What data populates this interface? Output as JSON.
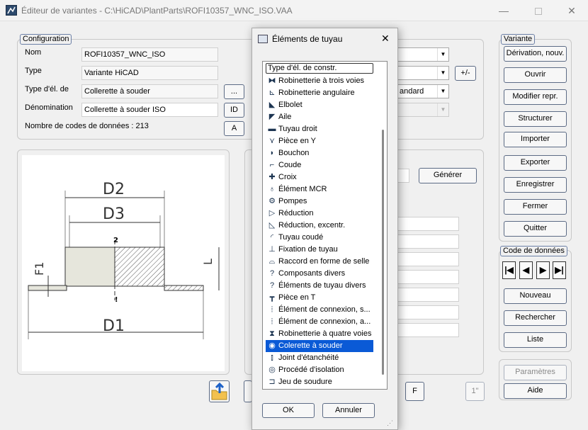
{
  "window": {
    "title": "Éditeur de variantes - C:\\HiCAD\\PlantParts\\ROFI10357_WNC_ISO.VAA",
    "minimize_icon": "minimize-icon",
    "maximize_icon": "maximize-icon",
    "close_label": "✕"
  },
  "configuration": {
    "legend": "Configuration",
    "nom_label": "Nom",
    "nom_value": "ROFI10357_WNC_ISO",
    "type_label": "Type",
    "type_value": "Variante HiCAD",
    "type_el_label": "Type d'él. de",
    "type_el_value": "Collerette à souder",
    "dots_button": "...",
    "denom_label": "Dénomination",
    "denom_value": "Collerette à souder ISO",
    "id_button": "ID",
    "nb_codes_label": "Nombre de codes de données : 213",
    "a_button": "A",
    "plus_minus_button": "+/-",
    "combo3_value": "andard"
  },
  "middle": {
    "generer_button": "Générer",
    "f_button": "F",
    "one_button": "1\""
  },
  "drawing": {
    "dims": [
      "D2",
      "D3",
      "D1",
      "F1",
      "L"
    ],
    "point_label": "2",
    "point_mark": "!"
  },
  "variante": {
    "legend": "Variante",
    "buttons": [
      "Dérivation, nouv.",
      "Ouvrir",
      "Modifier repr.",
      "Structurer",
      "Importer",
      "Exporter",
      "Enregistrer",
      "Fermer",
      "Quitter"
    ]
  },
  "code_donnees": {
    "legend": "Code de données",
    "nav": [
      "|◀",
      "◀",
      "▶",
      "▶|"
    ],
    "buttons": [
      "Nouveau",
      "Rechercher",
      "Liste"
    ]
  },
  "bottom_right": {
    "parametres": "Paramètres",
    "aide": "Aide"
  },
  "dialog": {
    "title": "Éléments de tuyau",
    "close_label": "✕",
    "items": [
      {
        "label": "Type d'él. de constr.",
        "icon": ""
      },
      {
        "label": "Robinetterie à trois voies",
        "icon": "valve-3way-icon"
      },
      {
        "label": "Robinetterie angulaire",
        "icon": "angle-valve-icon"
      },
      {
        "label": "Elbolet",
        "icon": "elbolet-icon"
      },
      {
        "label": "Aile",
        "icon": "wing-icon"
      },
      {
        "label": "Tuyau droit",
        "icon": "straight-pipe-icon"
      },
      {
        "label": "Pièce en Y",
        "icon": "y-piece-icon"
      },
      {
        "label": "Bouchon",
        "icon": "cap-icon"
      },
      {
        "label": "Coude",
        "icon": "elbow-icon"
      },
      {
        "label": "Croix",
        "icon": "cross-icon"
      },
      {
        "label": "Élément MCR",
        "icon": "mcr-icon"
      },
      {
        "label": "Pompes",
        "icon": "pump-icon"
      },
      {
        "label": "Réduction",
        "icon": "reducer-icon"
      },
      {
        "label": "Réduction, excentr.",
        "icon": "eccentric-reducer-icon"
      },
      {
        "label": "Tuyau coudé",
        "icon": "bent-pipe-icon"
      },
      {
        "label": "Fixation de tuyau",
        "icon": "pipe-support-icon"
      },
      {
        "label": "Raccord en forme de selle",
        "icon": "saddle-icon"
      },
      {
        "label": "Composants divers",
        "icon": "question-icon"
      },
      {
        "label": "Éléments de tuyau divers",
        "icon": "question-icon"
      },
      {
        "label": "Pièce en T",
        "icon": "tee-icon"
      },
      {
        "label": "Élément de connexion, s...",
        "icon": "connection-icon"
      },
      {
        "label": "Élément de connexion, a...",
        "icon": "connection-icon"
      },
      {
        "label": "Robinetterie à quatre voies",
        "icon": "valve-4way-icon"
      },
      {
        "label": "Colerette à souder",
        "icon": "weld-neck-icon"
      },
      {
        "label": "Joint d'étanchéité",
        "icon": "gasket-icon"
      },
      {
        "label": "Procédé d'isolation",
        "icon": "insulation-icon"
      },
      {
        "label": "Jeu de soudure",
        "icon": "weld-gap-icon"
      }
    ],
    "selected_index": 23,
    "ok_button": "OK",
    "cancel_button": "Annuler"
  }
}
